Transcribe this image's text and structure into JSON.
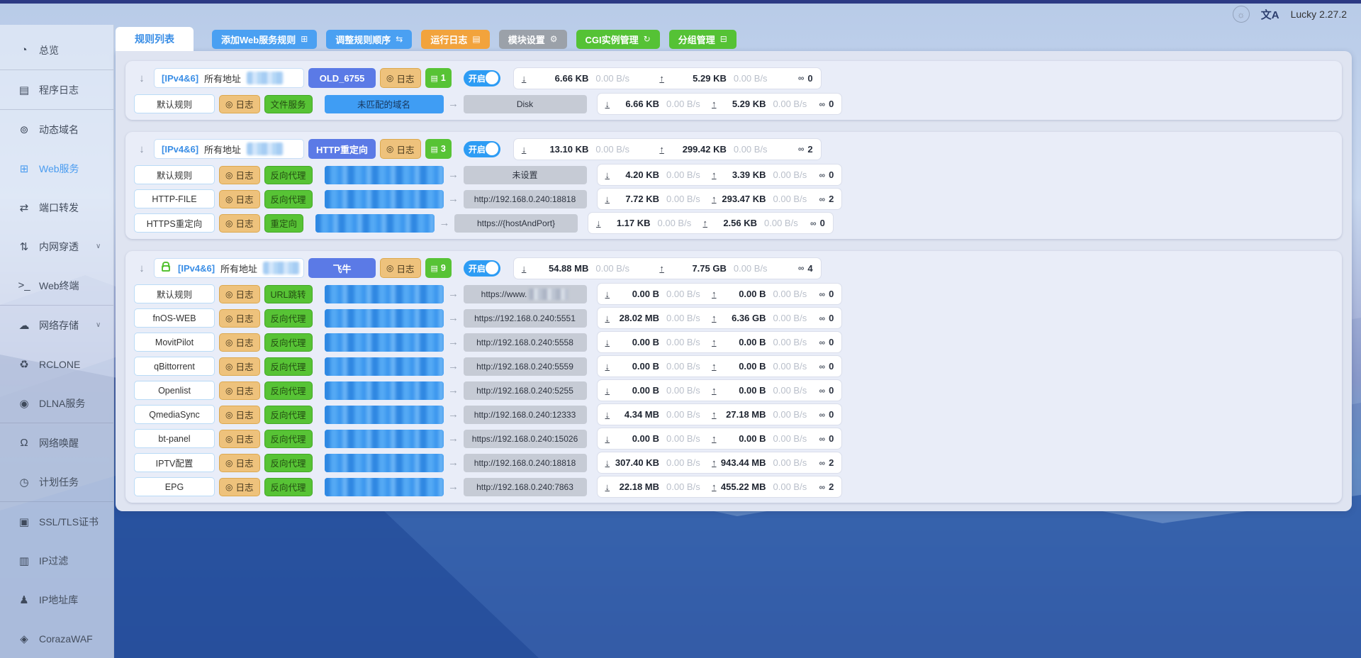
{
  "app": {
    "version": "Lucky 2.27.2"
  },
  "icons": {
    "brightness": "☼",
    "translate": "文A",
    "collapse": "↓",
    "right_arrow": "→",
    "eye": "◎",
    "doc": "▤",
    "down": "↓",
    "up": "↑",
    "link": "∞",
    "chevron": "∨"
  },
  "sidebar": {
    "items": [
      {
        "id": "overview",
        "label": "总览",
        "icon": "gauge-icon",
        "glyph": "◔"
      },
      {
        "id": "program-logs",
        "label": "程序日志",
        "icon": "log-icon",
        "glyph": "▤",
        "divider_before": true
      },
      {
        "id": "ddns",
        "label": "动态域名",
        "icon": "dns-icon",
        "glyph": "⊚",
        "divider_before": true
      },
      {
        "id": "web-service",
        "label": "Web服务",
        "icon": "web-service-icon",
        "glyph": "⊞",
        "active": true
      },
      {
        "id": "port-forward",
        "label": "端口转发",
        "icon": "port-forward-icon",
        "glyph": "⇄"
      },
      {
        "id": "nat-traversal",
        "label": "内网穿透",
        "icon": "nat-icon",
        "glyph": "⇅",
        "chevron": true
      },
      {
        "id": "web-terminal",
        "label": "Web终端",
        "icon": "terminal-icon",
        "glyph": ">_"
      },
      {
        "id": "network-storage",
        "label": "网络存储",
        "icon": "cloud-icon",
        "glyph": "☁",
        "chevron": true,
        "divider_before": true
      },
      {
        "id": "rclone",
        "label": "RCLONE",
        "icon": "rclone-icon",
        "glyph": "♻"
      },
      {
        "id": "dlna",
        "label": "DLNA服务",
        "icon": "dlna-icon",
        "glyph": "◉"
      },
      {
        "id": "wake-on-lan",
        "label": "网络唤醒",
        "icon": "bell-icon",
        "glyph": "Ω",
        "divider_before": true
      },
      {
        "id": "scheduled-tasks",
        "label": "计划任务",
        "icon": "clock-icon",
        "glyph": "◷"
      },
      {
        "id": "ssl-cert",
        "label": "SSL/TLS证书",
        "icon": "certificate-icon",
        "glyph": "▣",
        "divider_before": true
      },
      {
        "id": "ip-filter",
        "label": "IP过滤",
        "icon": "ip-filter-icon",
        "glyph": "▥"
      },
      {
        "id": "ip-library",
        "label": "IP地址库",
        "icon": "person-icon",
        "glyph": "♟"
      },
      {
        "id": "coraza-waf",
        "label": "CorazaWAF",
        "icon": "shield-icon",
        "glyph": "◈"
      }
    ]
  },
  "toolbar": {
    "tab": "规则列表",
    "buttons": [
      {
        "id": "add-rule",
        "label": "添加Web服务规则",
        "glyph": "⊞",
        "style": "blue",
        "icon": "add-document-icon"
      },
      {
        "id": "reorder-rules",
        "label": "调整规则顺序",
        "glyph": "⇆",
        "style": "blue",
        "icon": "reorder-icon"
      },
      {
        "id": "run-log",
        "label": "运行日志",
        "glyph": "▤",
        "style": "orange",
        "icon": "document-icon"
      },
      {
        "id": "module-settings",
        "label": "模块设置",
        "glyph": "⚙",
        "style": "gray",
        "icon": "gear-icon"
      },
      {
        "id": "cgi-manage",
        "label": "CGI实例管理",
        "glyph": "↻",
        "style": "green",
        "icon": "refresh-icon"
      },
      {
        "id": "group-manage",
        "label": "分组管理",
        "glyph": "⊟",
        "style": "green",
        "icon": "folder-icon"
      }
    ]
  },
  "groups": [
    {
      "locked": false,
      "ip_label": "[IPv4&6]",
      "addr_label": "所有地址",
      "tag": "OLD_6755",
      "log_label": "日志",
      "count": "1",
      "toggle_label": "开启",
      "stats": {
        "down": "6.66 KB",
        "down_speed": "0.00 B/s",
        "up": "5.29 KB",
        "up_speed": "0.00 B/s",
        "conns": "0"
      },
      "rules": [
        {
          "name": "默认规则",
          "log_label": "日志",
          "type": "文件服务",
          "domain_text": "未匹配的域名",
          "domain_redacted": false,
          "target": "Disk",
          "target_redacted": false,
          "stats": {
            "down": "6.66 KB",
            "down_speed": "0.00 B/s",
            "up": "5.29 KB",
            "up_speed": "0.00 B/s",
            "conns": "0"
          }
        }
      ]
    },
    {
      "locked": false,
      "ip_label": "[IPv4&6]",
      "addr_label": "所有地址",
      "tag": "HTTP重定向",
      "log_label": "日志",
      "count": "3",
      "toggle_label": "开启",
      "stats": {
        "down": "13.10 KB",
        "down_speed": "0.00 B/s",
        "up": "299.42 KB",
        "up_speed": "0.00 B/s",
        "conns": "2"
      },
      "rules": [
        {
          "name": "默认规则",
          "log_label": "日志",
          "type": "反向代理",
          "domain_redacted": true,
          "target": "未设置",
          "target_redacted": false,
          "stats": {
            "down": "4.20 KB",
            "down_speed": "0.00 B/s",
            "up": "3.39 KB",
            "up_speed": "0.00 B/s",
            "conns": "0"
          }
        },
        {
          "name": "HTTP-FILE",
          "log_label": "日志",
          "type": "反向代理",
          "domain_redacted": true,
          "target": "http://192.168.0.240:18818",
          "target_redacted": false,
          "stats": {
            "down": "7.72 KB",
            "down_speed": "0.00 B/s",
            "up": "293.47 KB",
            "up_speed": "0.00 B/s",
            "conns": "2"
          }
        },
        {
          "name": "HTTPS重定向",
          "log_label": "日志",
          "type": "重定向",
          "domain_redacted": true,
          "target": "https://{hostAndPort}",
          "target_redacted": false,
          "stats": {
            "down": "1.17 KB",
            "down_speed": "0.00 B/s",
            "up": "2.56 KB",
            "up_speed": "0.00 B/s",
            "conns": "0"
          }
        }
      ]
    },
    {
      "locked": true,
      "ip_label": "[IPv4&6]",
      "addr_label": "所有地址",
      "tag": "飞牛",
      "log_label": "日志",
      "count": "9",
      "toggle_label": "开启",
      "stats": {
        "down": "54.88 MB",
        "down_speed": "0.00 B/s",
        "up": "7.75 GB",
        "up_speed": "0.00 B/s",
        "conns": "4"
      },
      "rules": [
        {
          "name": "默认规则",
          "log_label": "日志",
          "type": "URL跳转",
          "domain_redacted": true,
          "target": "https://www.",
          "target_redacted": true,
          "stats": {
            "down": "0.00 B",
            "down_speed": "0.00 B/s",
            "up": "0.00 B",
            "up_speed": "0.00 B/s",
            "conns": "0"
          }
        },
        {
          "name": "fnOS-WEB",
          "log_label": "日志",
          "type": "反向代理",
          "domain_redacted": true,
          "target": "https://192.168.0.240:5551",
          "target_redacted": false,
          "stats": {
            "down": "28.02 MB",
            "down_speed": "0.00 B/s",
            "up": "6.36 GB",
            "up_speed": "0.00 B/s",
            "conns": "0"
          }
        },
        {
          "name": "MovitPilot",
          "log_label": "日志",
          "type": "反向代理",
          "domain_redacted": true,
          "target": "http://192.168.0.240:5558",
          "target_redacted": false,
          "stats": {
            "down": "0.00 B",
            "down_speed": "0.00 B/s",
            "up": "0.00 B",
            "up_speed": "0.00 B/s",
            "conns": "0"
          }
        },
        {
          "name": "qBittorrent",
          "log_label": "日志",
          "type": "反向代理",
          "domain_redacted": true,
          "target": "http://192.168.0.240:5559",
          "target_redacted": false,
          "stats": {
            "down": "0.00 B",
            "down_speed": "0.00 B/s",
            "up": "0.00 B",
            "up_speed": "0.00 B/s",
            "conns": "0"
          }
        },
        {
          "name": "Openlist",
          "log_label": "日志",
          "type": "反向代理",
          "domain_redacted": true,
          "target": "http://192.168.0.240:5255",
          "target_redacted": false,
          "stats": {
            "down": "0.00 B",
            "down_speed": "0.00 B/s",
            "up": "0.00 B",
            "up_speed": "0.00 B/s",
            "conns": "0"
          }
        },
        {
          "name": "QmediaSync",
          "log_label": "日志",
          "type": "反向代理",
          "domain_redacted": true,
          "target": "http://192.168.0.240:12333",
          "target_redacted": false,
          "stats": {
            "down": "4.34 MB",
            "down_speed": "0.00 B/s",
            "up": "27.18 MB",
            "up_speed": "0.00 B/s",
            "conns": "0"
          }
        },
        {
          "name": "bt-panel",
          "log_label": "日志",
          "type": "反向代理",
          "domain_redacted": true,
          "target": "https://192.168.0.240:15026",
          "target_redacted": false,
          "stats": {
            "down": "0.00 B",
            "down_speed": "0.00 B/s",
            "up": "0.00 B",
            "up_speed": "0.00 B/s",
            "conns": "0"
          }
        },
        {
          "name": "IPTV配置",
          "log_label": "日志",
          "type": "反向代理",
          "domain_redacted": true,
          "target": "http://192.168.0.240:18818",
          "target_redacted": false,
          "stats": {
            "down": "307.40 KB",
            "down_speed": "0.00 B/s",
            "up": "943.44 MB",
            "up_speed": "0.00 B/s",
            "conns": "2"
          }
        },
        {
          "name": "EPG",
          "log_label": "日志",
          "type": "反向代理",
          "domain_redacted": true,
          "target": "http://192.168.0.240:7863",
          "target_redacted": false,
          "stats": {
            "down": "22.18 MB",
            "down_speed": "0.00 B/s",
            "up": "455.22 MB",
            "up_speed": "0.00 B/s",
            "conns": "2"
          }
        }
      ]
    }
  ]
}
